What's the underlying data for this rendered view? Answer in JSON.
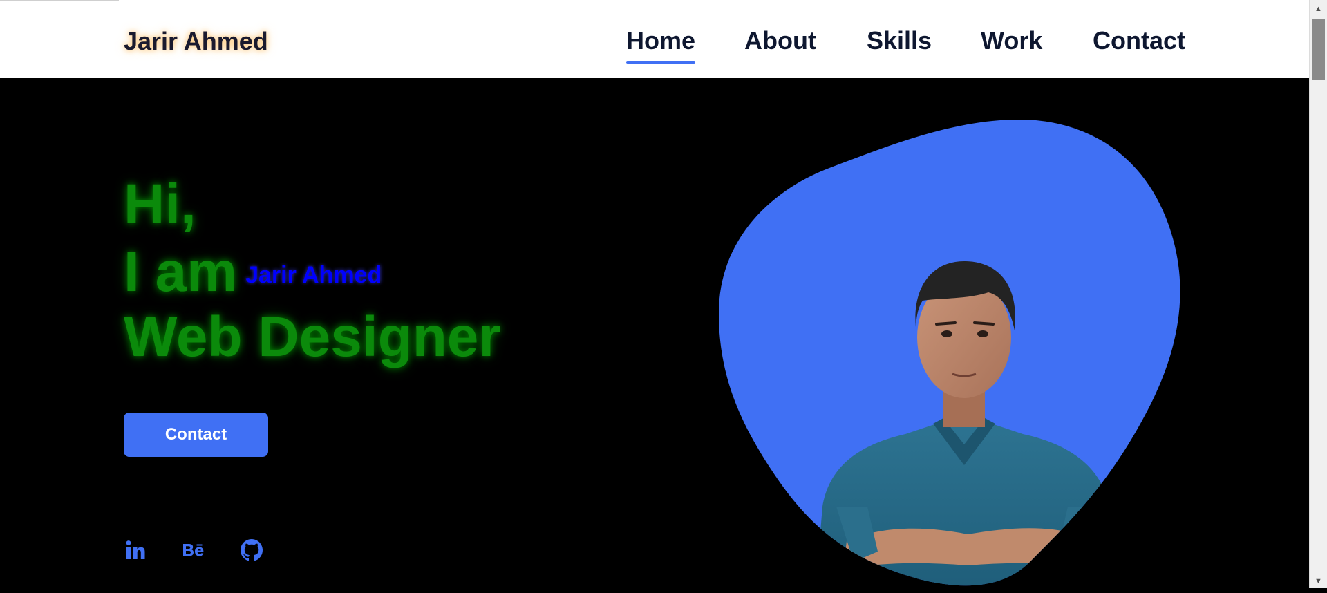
{
  "header": {
    "logo": "Jarir Ahmed",
    "nav": [
      {
        "label": "Home",
        "active": true
      },
      {
        "label": "About",
        "active": false
      },
      {
        "label": "Skills",
        "active": false
      },
      {
        "label": "Work",
        "active": false
      },
      {
        "label": "Contact",
        "active": false
      }
    ]
  },
  "hero": {
    "line1": "Hi,",
    "line2_prefix": "I am",
    "name": "Jarir Ahmed",
    "line3": "Web Designer",
    "cta_label": "Contact",
    "photo_alt": "Portrait of Jarir Ahmed"
  },
  "social": [
    {
      "name": "LinkedIn",
      "icon": "linkedin-icon"
    },
    {
      "name": "Behance",
      "icon": "behance-icon"
    },
    {
      "name": "GitHub",
      "icon": "github-icon"
    }
  ],
  "colors": {
    "accent": "#4070f4",
    "greeting_green": "#0b8a0b",
    "name_blue": "#0000ff",
    "nav_text": "#0e1730",
    "background": "#000000"
  }
}
